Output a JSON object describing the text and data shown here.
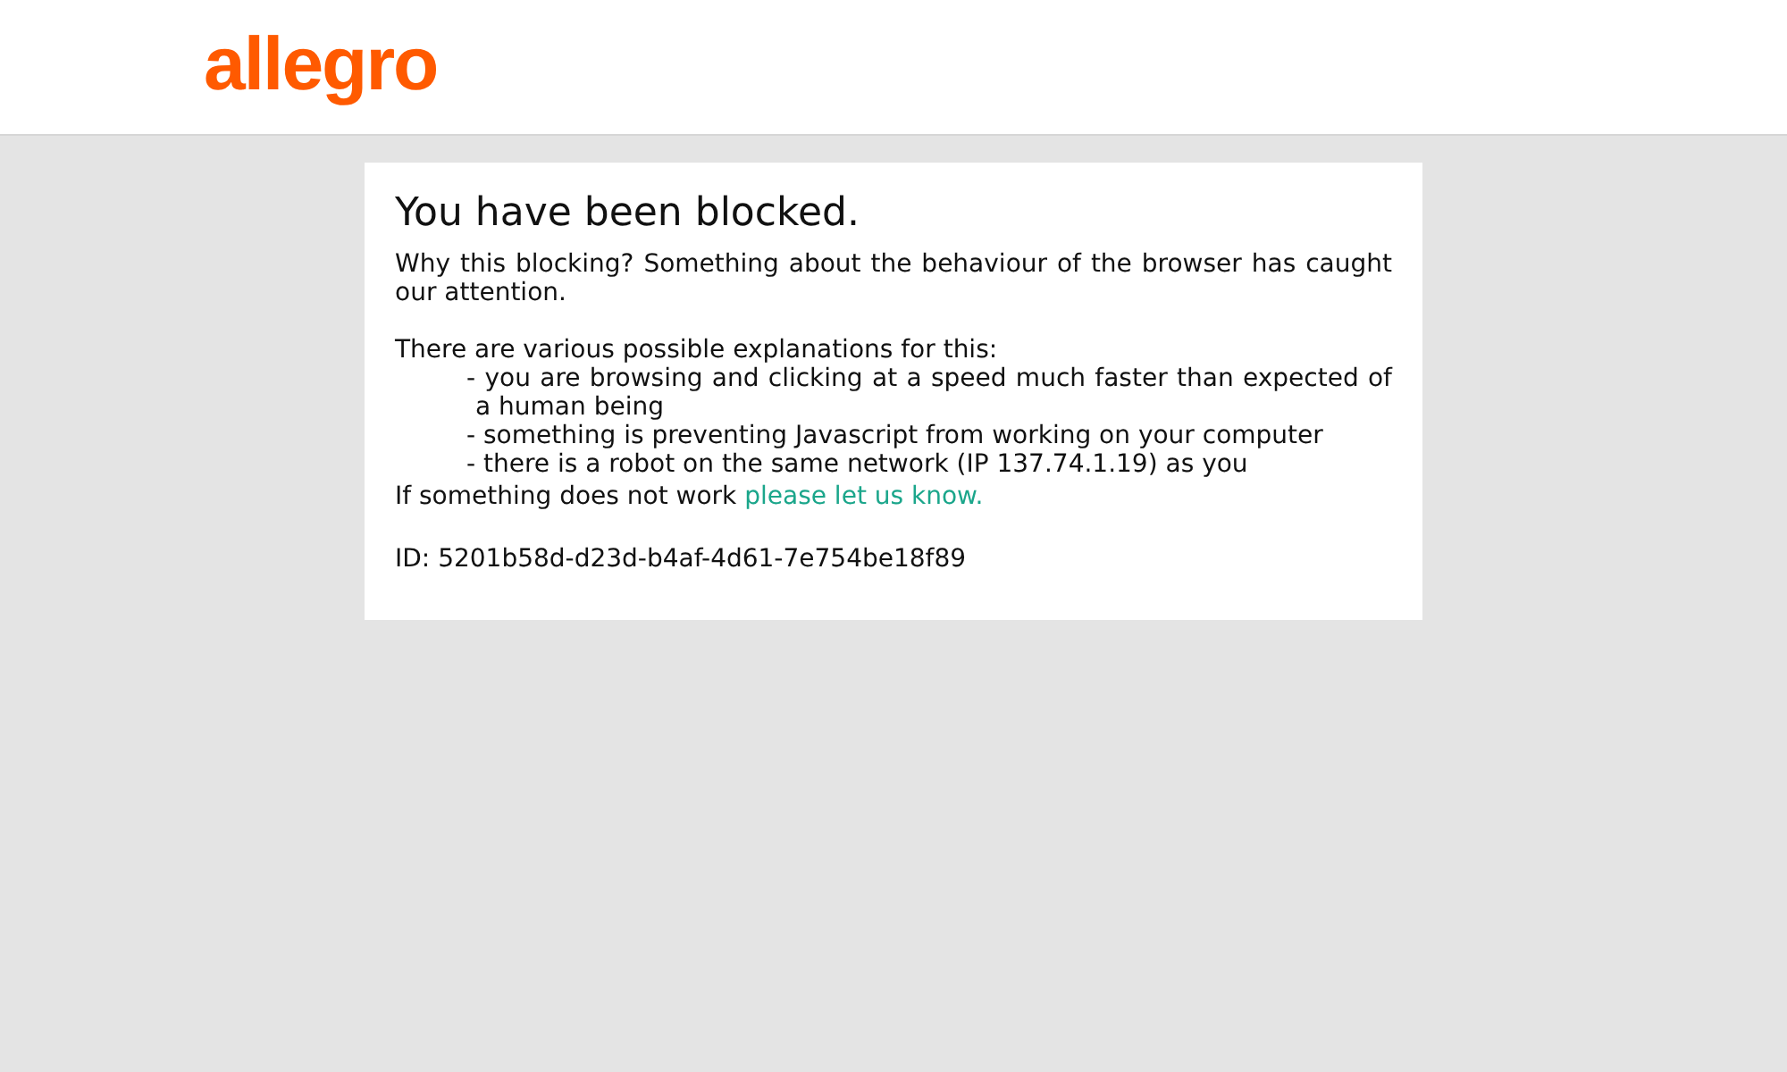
{
  "header": {
    "logo": "allegro"
  },
  "notice": {
    "title": "You have been blocked.",
    "intro": "Why this blocking? Something about the behaviour of the browser has caught our attention.",
    "lead": "There are various possible explanations for this:",
    "reasons": [
      "- you are browsing and clicking at a speed much faster than expected of a human being",
      "- something is preventing Javascript from working on your computer",
      "- there is a robot on the same network (IP 137.74.1.19) as you"
    ],
    "contact_text": "If something does not work",
    "contact_link": "please let us know.",
    "id": "ID: 5201b58d-d23d-b4af-4d61-7e754be18f89"
  }
}
